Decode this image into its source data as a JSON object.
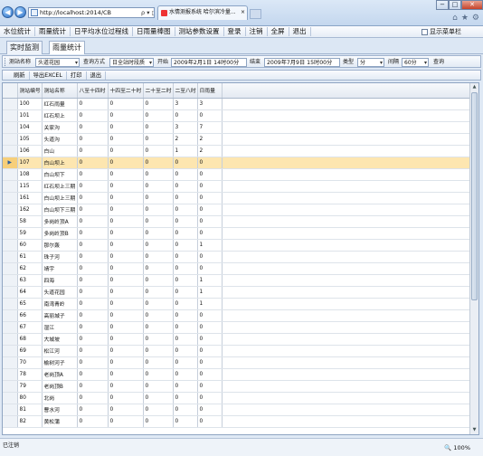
{
  "browser": {
    "address": "http://localhost:2014/CB",
    "address_tools": "ρ ▾ ▯ ⊠ ✕",
    "tab_title": "水情测报系统 哈尔滨冷量...",
    "tab_close": "×",
    "back_glyph": "◀",
    "fwd_glyph": "▶",
    "min_glyph": "−",
    "max_glyph": "□",
    "close_glyph": "✕",
    "home_icon": "⌂",
    "favorites_icon": "★",
    "settings_icon": "⚙"
  },
  "menu": {
    "items": [
      "水位统计",
      "雨量统计",
      "日平均水位过程线",
      "日雨量棒图",
      "测站参数设置",
      "登录",
      "注销",
      "全屏",
      "退出"
    ],
    "show_menu_label": "显示菜单栏"
  },
  "module_tabs": [
    "实时监测",
    "雨量统计"
  ],
  "filters": {
    "station_name_label": "测站名称",
    "station_name_value": "头道花园",
    "query_mode_label": "查询方式",
    "query_mode_value": "日全站时段质",
    "start_label": "开始",
    "start_value": "2009年2月1日 14时00分",
    "end_label": "结束",
    "end_value": "2009年7月9日 15时00分",
    "type_label": "类型",
    "type_value": "分",
    "interval_label": "间隔",
    "interval_value": "60分",
    "query_button": "查询"
  },
  "actions": [
    "刷新",
    "导出EXCEL",
    "打印",
    "退出"
  ],
  "grid": {
    "columns": [
      "测站编号",
      "测站名称",
      "八至十四时",
      "十四至二十时",
      "二十至二时",
      "二至八时",
      "日雨量"
    ],
    "selected_row_index": 5,
    "selected_marker": "▶",
    "rows": [
      [
        "100",
        "红石雨量",
        "0",
        "0",
        "0",
        "3",
        "3"
      ],
      [
        "101",
        "红石坝上",
        "0",
        "0",
        "0",
        "0",
        "0"
      ],
      [
        "104",
        "关家沟",
        "0",
        "0",
        "0",
        "3",
        "7"
      ],
      [
        "105",
        "头道沟",
        "0",
        "0",
        "0",
        "2",
        "2"
      ],
      [
        "106",
        "白山",
        "0",
        "0",
        "0",
        "1",
        "2"
      ],
      [
        "107",
        "白山坝上",
        "0",
        "0",
        "0",
        "0",
        "0"
      ],
      [
        "108",
        "白山坝下",
        "0",
        "0",
        "0",
        "0",
        "0"
      ],
      [
        "115",
        "红石坝上三期",
        "0",
        "0",
        "0",
        "0",
        "0"
      ],
      [
        "161",
        "白山坝上三期",
        "0",
        "0",
        "0",
        "0",
        "0"
      ],
      [
        "162",
        "白山坝下三期",
        "0",
        "0",
        "0",
        "0",
        "0"
      ],
      [
        "58",
        "多岗岭顶A",
        "0",
        "0",
        "0",
        "0",
        "0"
      ],
      [
        "59",
        "多岗岭顶B",
        "0",
        "0",
        "0",
        "0",
        "0"
      ],
      [
        "60",
        "那尔轰",
        "0",
        "0",
        "0",
        "0",
        "1"
      ],
      [
        "61",
        "珠子河",
        "0",
        "0",
        "0",
        "0",
        "0"
      ],
      [
        "62",
        "靖宇",
        "0",
        "0",
        "0",
        "0",
        "0"
      ],
      [
        "63",
        "四海",
        "0",
        "0",
        "0",
        "0",
        "1"
      ],
      [
        "64",
        "头道花园",
        "0",
        "0",
        "0",
        "0",
        "1"
      ],
      [
        "65",
        "南湾青岭",
        "0",
        "0",
        "0",
        "0",
        "1"
      ],
      [
        "66",
        "高丽城子",
        "0",
        "0",
        "0",
        "0",
        "0"
      ],
      [
        "67",
        "湿江",
        "0",
        "0",
        "0",
        "0",
        "0"
      ],
      [
        "68",
        "大城坡",
        "0",
        "0",
        "0",
        "0",
        "0"
      ],
      [
        "69",
        "松江河",
        "0",
        "0",
        "0",
        "0",
        "0"
      ],
      [
        "70",
        "榆树河子",
        "0",
        "0",
        "0",
        "0",
        "0"
      ],
      [
        "78",
        "老岗顶A",
        "0",
        "0",
        "0",
        "0",
        "0"
      ],
      [
        "79",
        "老岗顶B",
        "0",
        "0",
        "0",
        "0",
        "0"
      ],
      [
        "80",
        "北岗",
        "0",
        "0",
        "0",
        "0",
        "0"
      ],
      [
        "81",
        "曹水河",
        "0",
        "0",
        "0",
        "0",
        "0"
      ],
      [
        "82",
        "黄松蒲",
        "0",
        "0",
        "0",
        "0",
        "0"
      ]
    ]
  },
  "status": {
    "text": "已注销",
    "zoom": "100%",
    "zoom_icon": "🔍"
  }
}
